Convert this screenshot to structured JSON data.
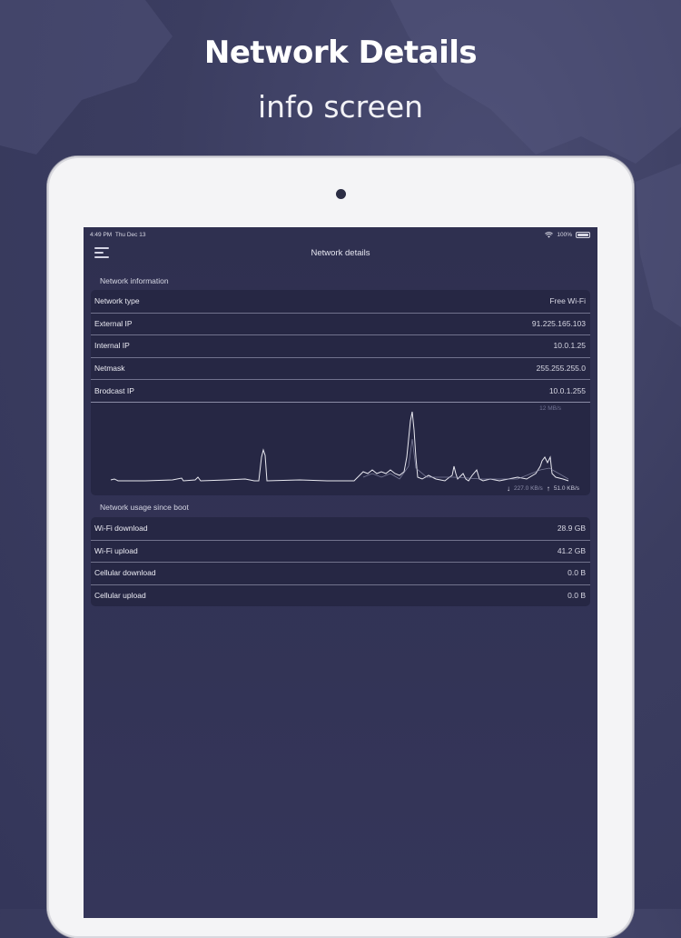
{
  "promo": {
    "title": "Network Details",
    "subtitle": "info screen"
  },
  "status_bar": {
    "time": "4:49 PM",
    "date": "Thu Dec 13",
    "battery": "100%"
  },
  "nav": {
    "title": "Network details"
  },
  "network_info": {
    "header": "Network information",
    "rows": [
      {
        "label": "Network type",
        "value": "Free Wi-Fi"
      },
      {
        "label": "External IP",
        "value": "91.225.165.103"
      },
      {
        "label": "Internal IP",
        "value": "10.0.1.25"
      },
      {
        "label": "Netmask",
        "value": "255.255.255.0"
      },
      {
        "label": "Brodcast IP",
        "value": "10.0.1.255"
      }
    ]
  },
  "traffic_chart": {
    "max_label": "12 MB/s",
    "download_speed": "227.0 KB/s",
    "upload_speed": "51.0 KB/s"
  },
  "usage": {
    "header": "Network usage since boot",
    "rows": [
      {
        "label": "Wi-Fi download",
        "value": "28.9 GB"
      },
      {
        "label": "Wi-Fi upload",
        "value": "41.2 GB"
      },
      {
        "label": "Cellular download",
        "value": "0.0 B"
      },
      {
        "label": "Cellular upload",
        "value": "0.0 B"
      }
    ]
  },
  "colors": {
    "background": "#3b3d60",
    "card": "#262744",
    "accent_line": "#e8e8f0",
    "separator": "#8b8ca6"
  },
  "icons": {
    "menu": "hamburger-menu-icon",
    "wifi": "wifi-icon",
    "battery": "battery-icon",
    "download": "arrow-down-icon",
    "upload": "arrow-up-icon"
  }
}
